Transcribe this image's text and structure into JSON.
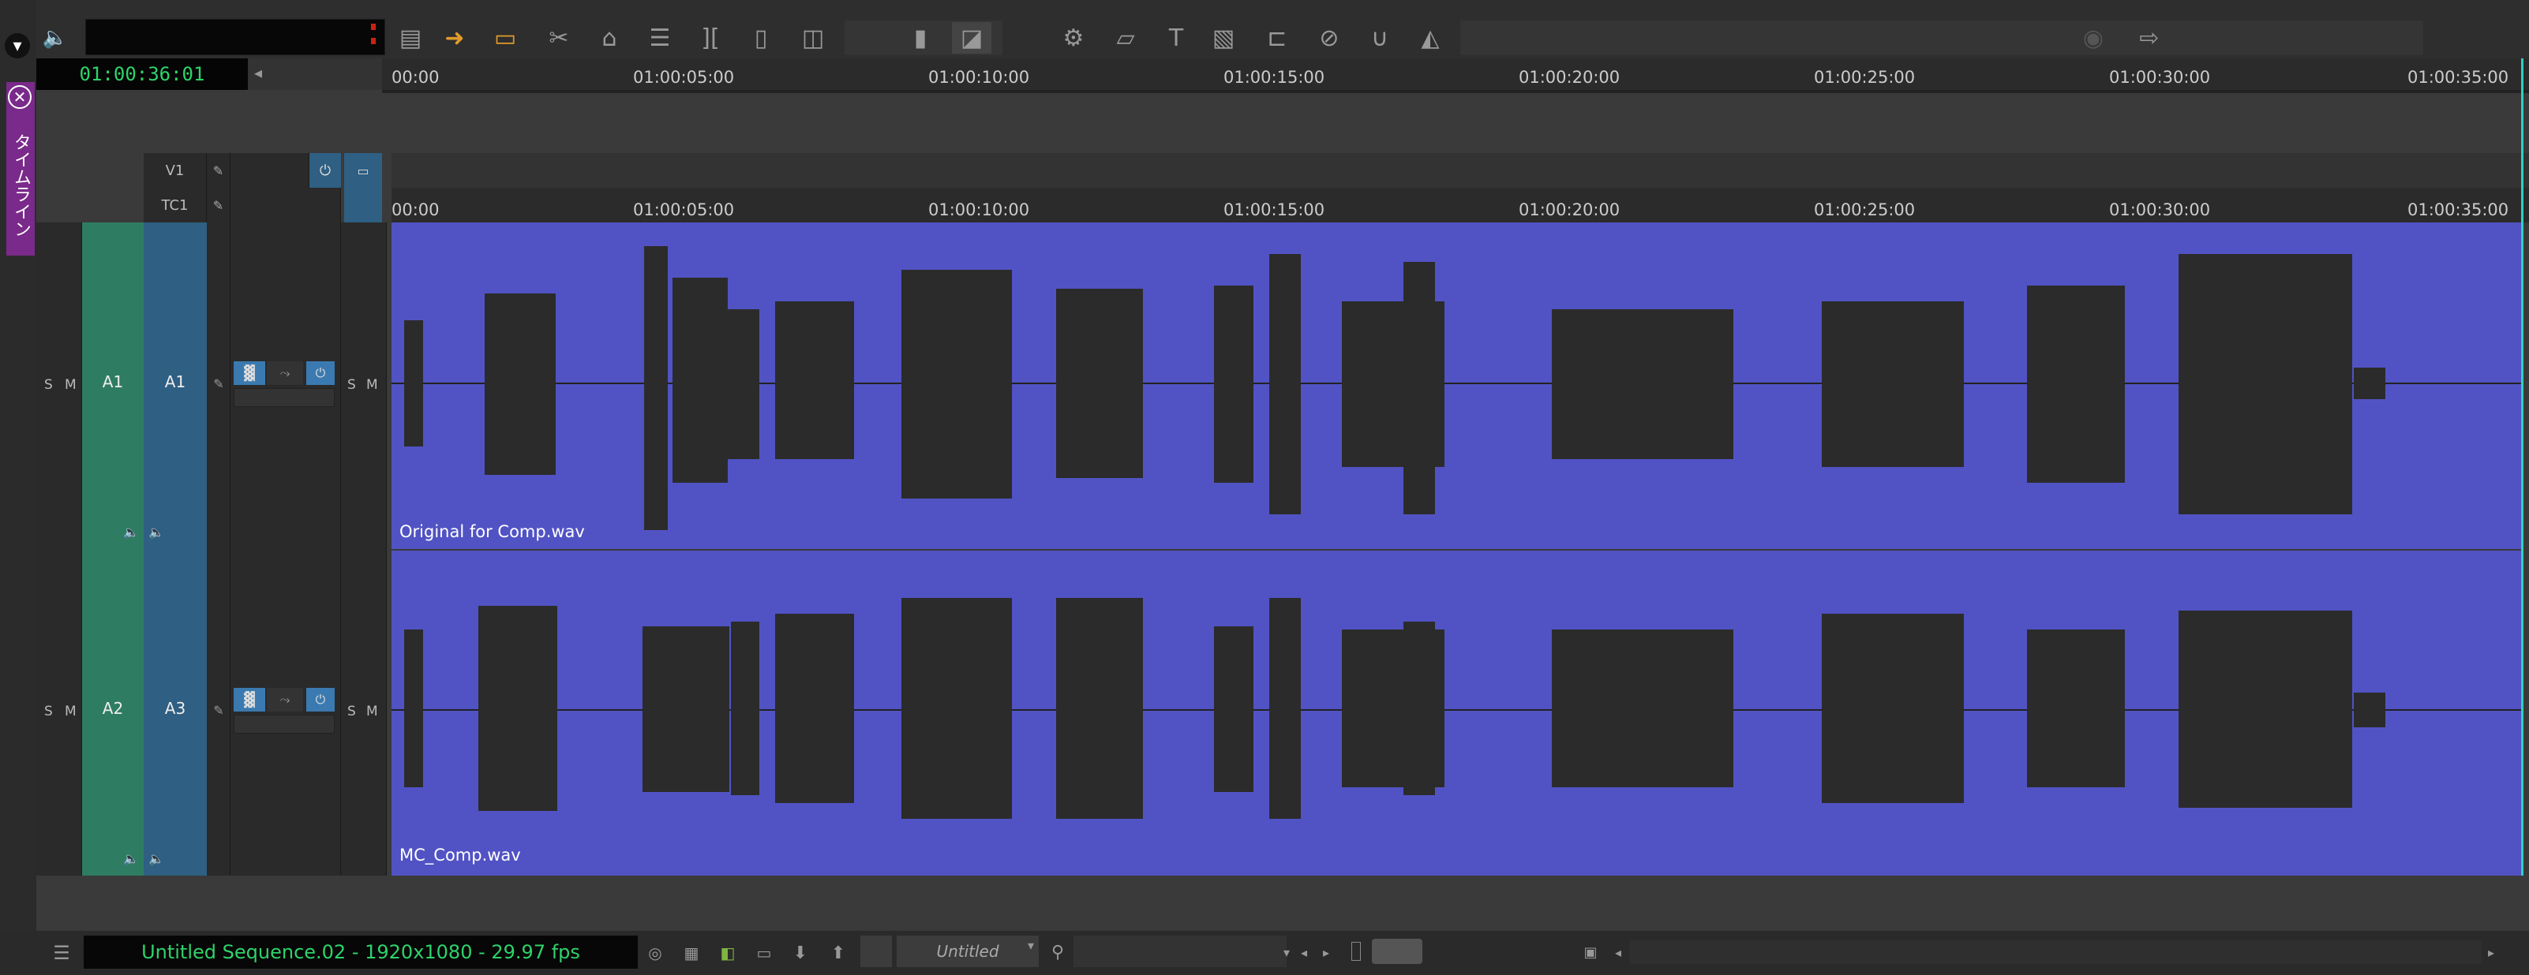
{
  "window": {
    "side_tab_label": "タイムライン"
  },
  "toolbar": {
    "icons": [
      "speaker-icon",
      "tool-1-icon",
      "lift-icon",
      "extract-icon",
      "razor-icon",
      "trim-icon",
      "segment-icon",
      "sync-icon",
      "split-icon",
      "match-icon",
      "mark-icon",
      "overwrite-icon",
      "settings-icon",
      "effect-icon",
      "title-text-icon",
      "fill-icon",
      "gap-icon",
      "disable-icon",
      "curve-icon",
      "warp-icon",
      "record-icon",
      "export-icon"
    ]
  },
  "timecode": {
    "current": "01:00:36:01"
  },
  "ruler": {
    "labels": [
      "00:00",
      "01:00:05:00",
      "01:00:10:00",
      "01:00:15:00",
      "01:00:20:00",
      "01:00:25:00",
      "01:00:30:00",
      "01:00:35:00"
    ]
  },
  "tracks": {
    "v1": "V1",
    "tc1": "TC1",
    "audio": [
      {
        "source": "A1",
        "record": "A1",
        "solo": "S",
        "mute": "M",
        "clip": "Original for Comp.wav"
      },
      {
        "source": "A2",
        "record": "A3",
        "solo": "S",
        "mute": "M",
        "clip": "MC_Comp.wav"
      }
    ]
  },
  "colors": {
    "clip": "#5153c4",
    "green": "#2e7d62",
    "blue": "#2f5f82",
    "timecode": "#2ed36a",
    "side_tab": "#7a2a8a"
  },
  "bottom": {
    "sequence": "Untitled Sequence.02 - 1920x1080 - 29.97 fps",
    "bin_menu": "Untitled"
  }
}
